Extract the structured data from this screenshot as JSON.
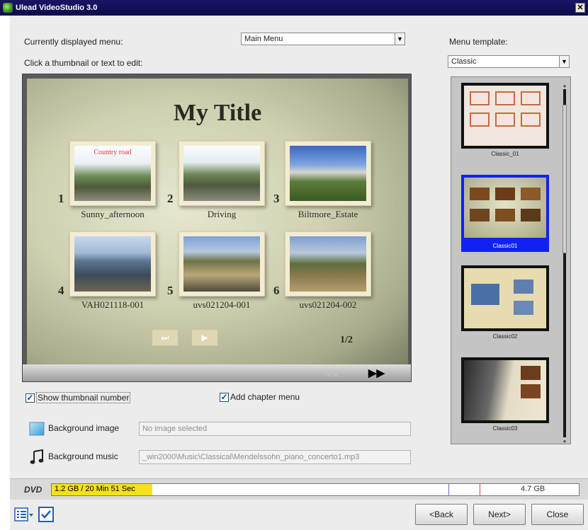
{
  "window": {
    "title": "Ulead VideoStudio 3.0"
  },
  "labels": {
    "currently_displayed_menu": "Currently displayed menu:",
    "click_hint": "Click a thumbnail or text to edit:",
    "menu_template": "Menu template:"
  },
  "menu_select": {
    "value": "Main Menu"
  },
  "template_select": {
    "value": "Classic"
  },
  "preview": {
    "title": "My Title",
    "page_indicator": "1/2",
    "thumbnails": [
      {
        "number": "1",
        "caption": "Sunny_afternoon",
        "overlay": "Country road"
      },
      {
        "number": "2",
        "caption": "Driving"
      },
      {
        "number": "3",
        "caption": "Biltmore_Estate"
      },
      {
        "number": "4",
        "caption": "VAH021118-001"
      },
      {
        "number": "5",
        "caption": "uvs021204-001"
      },
      {
        "number": "6",
        "caption": "uvs021204-002"
      }
    ],
    "nav": {
      "skip_glyph": "⏭",
      "play_glyph": "▶"
    },
    "bar": {
      "prev_glyph": "◀◀",
      "next_glyph": "▶▶"
    }
  },
  "options": {
    "show_thumbnail_number": {
      "label": "Show thumbnail number",
      "checked": true
    },
    "add_chapter_menu": {
      "label": "Add chapter menu",
      "checked": true
    }
  },
  "background_image": {
    "label": "Background image",
    "value": "No image selected"
  },
  "background_music": {
    "label": "Background music",
    "value": "_win2000\\Music\\Classical\\Mendelssohn_piano_concerto1.mp3"
  },
  "templates": [
    {
      "caption": "Classic_01"
    },
    {
      "caption": "Classic01"
    },
    {
      "caption": "Classic02"
    },
    {
      "caption": "Classic03"
    }
  ],
  "dvd": {
    "label": "DVD",
    "usage_text": "1.2 GB / 20 Min 51 Sec",
    "usage_fraction": 0.191,
    "capacity": "4.7 GB",
    "fill_color": "#f5e11b"
  },
  "buttons": {
    "back": "<Back",
    "next": "Next>",
    "close": "Close"
  },
  "icons": {
    "check": "✓"
  }
}
